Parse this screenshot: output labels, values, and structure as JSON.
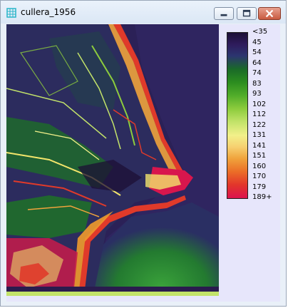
{
  "window": {
    "title": "cullera_1956"
  },
  "legend": {
    "labels": [
      "<35",
      "45",
      "54",
      "64",
      "74",
      "83",
      "93",
      "102",
      "112",
      "122",
      "131",
      "141",
      "151",
      "160",
      "170",
      "179",
      "189+"
    ]
  },
  "colors": {
    "deep": "#2a1c4e",
    "water": "#2f2560",
    "sea_green": "#2f8f2f",
    "land_green": "#1f6e2a",
    "yellow": "#f3e56b",
    "orange": "#ef9b2c",
    "red": "#e03a2a",
    "magenta": "#d8164d"
  }
}
